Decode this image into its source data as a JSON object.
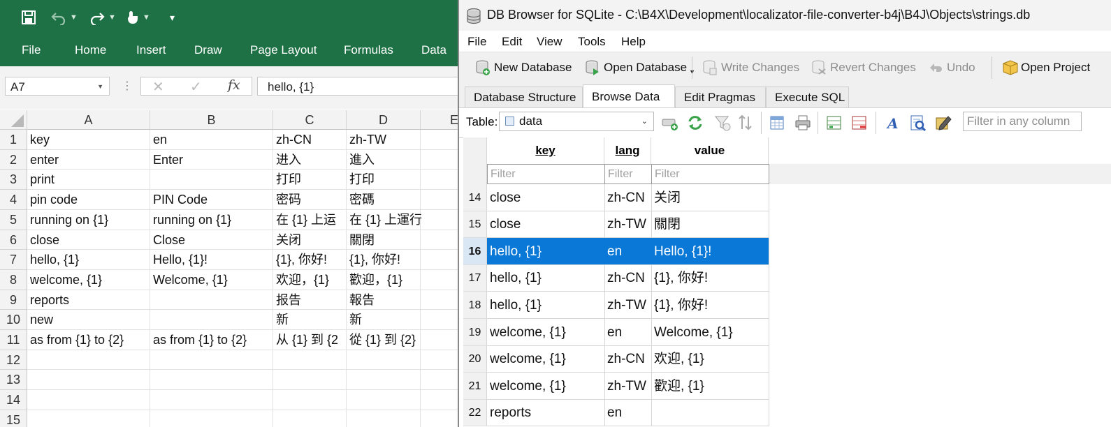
{
  "excel": {
    "qat": {
      "save_icon": "save-icon",
      "undo_icon": "undo-icon",
      "redo_icon": "redo-icon",
      "touch_icon": "touch-mode-icon",
      "customize_icon": "customize-qat-icon"
    },
    "ribbon_tabs": [
      "File",
      "Home",
      "Insert",
      "Draw",
      "Page Layout",
      "Formulas",
      "Data"
    ],
    "name_box": "A7",
    "formula": "hello, {1}",
    "fx_label": "fx",
    "columns": [
      "A",
      "B",
      "C",
      "D",
      "E"
    ],
    "rows": [
      {
        "num": "1",
        "cells": [
          "key",
          "en",
          "zh-CN",
          "zh-TW"
        ]
      },
      {
        "num": "2",
        "cells": [
          "enter",
          "Enter",
          "进入",
          "進入"
        ]
      },
      {
        "num": "3",
        "cells": [
          "print",
          "",
          "打印",
          "打印"
        ]
      },
      {
        "num": "4",
        "cells": [
          "pin code",
          "PIN Code",
          "密码",
          "密碼"
        ]
      },
      {
        "num": "5",
        "cells": [
          "running on {1}",
          "running on {1}",
          "在 {1} 上运",
          "在 {1} 上運行"
        ]
      },
      {
        "num": "6",
        "cells": [
          "close",
          "Close",
          "关闭",
          "關閉"
        ]
      },
      {
        "num": "7",
        "cells": [
          "hello, {1}",
          "Hello, {1}!",
          "{1}, 你好!",
          "{1}, 你好!"
        ]
      },
      {
        "num": "8",
        "cells": [
          "welcome, {1}",
          "Welcome, {1}",
          "欢迎，{1}",
          "歡迎，{1}"
        ]
      },
      {
        "num": "9",
        "cells": [
          "reports",
          "",
          "报告",
          "報告"
        ]
      },
      {
        "num": "10",
        "cells": [
          "new",
          "",
          "新",
          "新"
        ]
      },
      {
        "num": "11",
        "cells": [
          "as from {1} to {2}",
          "as from {1} to {2}",
          "从 {1} 到 {2",
          "從 {1} 到 {2}"
        ]
      },
      {
        "num": "12",
        "cells": [
          "",
          "",
          "",
          ""
        ]
      },
      {
        "num": "13",
        "cells": [
          "",
          "",
          "",
          ""
        ]
      },
      {
        "num": "14",
        "cells": [
          "",
          "",
          "",
          ""
        ]
      },
      {
        "num": "15",
        "cells": [
          "",
          "",
          "",
          ""
        ]
      }
    ]
  },
  "dbbrowser": {
    "title": "DB Browser for SQLite - C:\\B4X\\Development\\localizator-file-converter-b4j\\B4J\\Objects\\strings.db",
    "menu": [
      "File",
      "Edit",
      "View",
      "Tools",
      "Help"
    ],
    "toolbar": {
      "new_database": "New Database",
      "open_database": "Open Database",
      "write_changes": "Write Changes",
      "revert_changes": "Revert Changes",
      "undo": "Undo",
      "open_project": "Open Project"
    },
    "tabs": [
      "Database Structure",
      "Browse Data",
      "Edit Pragmas",
      "Execute SQL"
    ],
    "active_tab": "Browse Data",
    "table_label": "Table:",
    "table_name": "data",
    "filter_any_placeholder": "Filter in any column",
    "grid": {
      "columns": [
        "key",
        "lang",
        "value"
      ],
      "filter_placeholder": "Filter",
      "selected_row": "16",
      "rows": [
        {
          "num": "14",
          "key": "close",
          "lang": "zh-CN",
          "value": "关闭"
        },
        {
          "num": "15",
          "key": "close",
          "lang": "zh-TW",
          "value": "關閉"
        },
        {
          "num": "16",
          "key": "hello, {1}",
          "lang": "en",
          "value": "Hello, {1}!"
        },
        {
          "num": "17",
          "key": "hello, {1}",
          "lang": "zh-CN",
          "value": "{1}, 你好!"
        },
        {
          "num": "18",
          "key": "hello, {1}",
          "lang": "zh-TW",
          "value": "{1}, 你好!"
        },
        {
          "num": "19",
          "key": "welcome, {1}",
          "lang": "en",
          "value": "Welcome, {1}"
        },
        {
          "num": "20",
          "key": "welcome, {1}",
          "lang": "zh-CN",
          "value": "欢迎, {1}"
        },
        {
          "num": "21",
          "key": "welcome, {1}",
          "lang": "zh-TW",
          "value": "歡迎, {1}"
        },
        {
          "num": "22",
          "key": "reports",
          "lang": "en",
          "value": ""
        }
      ]
    }
  },
  "colors": {
    "excel_green": "#1e7145",
    "selection_blue": "#0a78d7"
  }
}
